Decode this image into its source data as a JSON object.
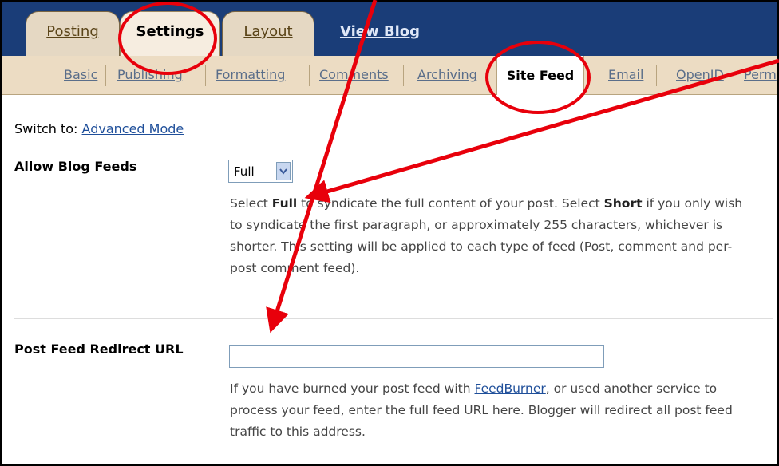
{
  "tabs": [
    {
      "label": "Posting"
    },
    {
      "label": "Settings"
    },
    {
      "label": "Layout"
    },
    {
      "label": "View Blog"
    }
  ],
  "subnav": [
    {
      "label": "Basic"
    },
    {
      "label": "Publishing"
    },
    {
      "label": "Formatting"
    },
    {
      "label": "Comments"
    },
    {
      "label": "Archiving"
    },
    {
      "label": "Site Feed"
    },
    {
      "label": "Email"
    },
    {
      "label": "OpenID"
    },
    {
      "label": "Perm"
    }
  ],
  "switch": {
    "prefix": "Switch to:",
    "link": "Advanced Mode"
  },
  "allow_feeds": {
    "label": "Allow Blog Feeds",
    "selected": "Full",
    "desc_1": "Select ",
    "desc_full": "Full",
    "desc_2": " to syndicate the full content of your post. Select ",
    "desc_short": "Short",
    "desc_3": " if you only wish to syndicate the first paragraph, or approximately 255 characters, whichever is shorter. This setting will be applied to each type of feed (Post, comment and per-post comment feed)."
  },
  "redirect": {
    "label": "Post Feed Redirect URL",
    "value": "",
    "desc_1": "If you have burned your post feed with ",
    "link": "FeedBurner",
    "desc_2": ", or used another service to process your feed, enter the full feed URL here. Blogger will redirect all post feed traffic to this address."
  },
  "colors": {
    "annotation": "#e8000b",
    "header": "#1a3d78",
    "subnav": "#ecdcc3",
    "link": "#1f4f9a"
  }
}
